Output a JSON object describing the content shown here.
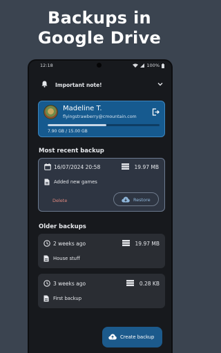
{
  "headline": {
    "line1": "Backups in",
    "line2": "Google Drive"
  },
  "status_bar": {
    "time": "12:18",
    "battery": "100%"
  },
  "note": {
    "label": "Important note!",
    "icon": "bell-icon",
    "toggle_icon": "chevron-down-icon"
  },
  "account": {
    "name": "Madeline T.",
    "email": "flyingstrawberry@cmountain.com",
    "quota_text": "7.90 GB / 15.00 GB",
    "quota_used_fraction": 0.527,
    "logout_icon": "logout-icon"
  },
  "recent": {
    "section_title": "Most recent backup",
    "date": "16/07/2024 20:58",
    "size": "19.97 MB",
    "message": "Added new games",
    "delete_label": "Delete",
    "restore_label": "Restore"
  },
  "older": {
    "section_title": "Older backups",
    "items": [
      {
        "when": "2 weeks ago",
        "size": "19.97 MB",
        "message": "House stuff"
      },
      {
        "when": "3 weeks ago",
        "size": "0.28 KB",
        "message": "First backup"
      }
    ]
  },
  "create_button": {
    "label": "Create backup"
  },
  "colors": {
    "background": "#3b4450",
    "screen": "#17191d",
    "account_card": "#165a8f",
    "card": "#2a2d33",
    "accent_restore": "#8fb6da",
    "delete": "#e0887f",
    "create_button": "#1c5a8c"
  }
}
